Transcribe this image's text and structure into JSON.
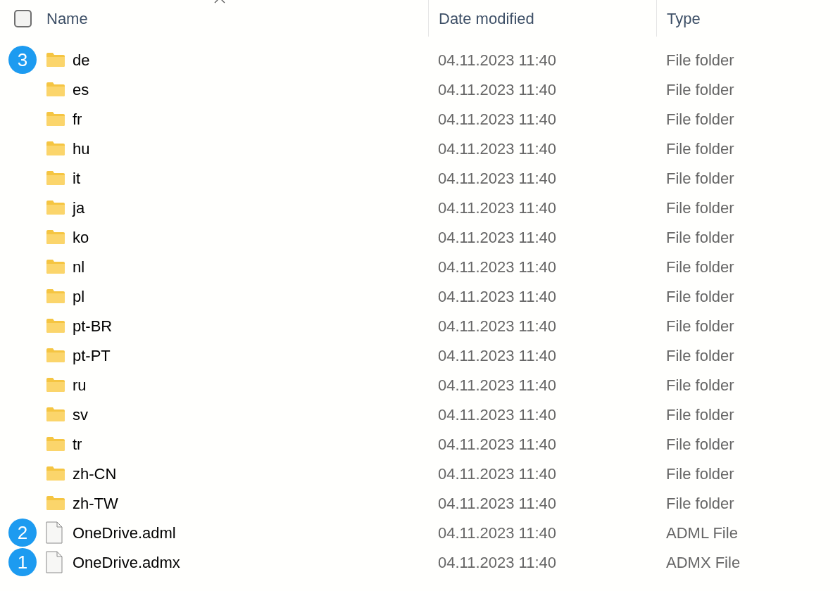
{
  "header": {
    "select_all": {
      "checked": false
    },
    "columns": [
      {
        "label": "Name",
        "sorted": true
      },
      {
        "label": "Date modified",
        "sorted": false
      },
      {
        "label": "Type",
        "sorted": false
      }
    ]
  },
  "rows": [
    {
      "kind": "folder",
      "name": "de",
      "date": "04.11.2023 11:40",
      "type": "File folder",
      "badge": "3"
    },
    {
      "kind": "folder",
      "name": "es",
      "date": "04.11.2023 11:40",
      "type": "File folder"
    },
    {
      "kind": "folder",
      "name": "fr",
      "date": "04.11.2023 11:40",
      "type": "File folder"
    },
    {
      "kind": "folder",
      "name": "hu",
      "date": "04.11.2023 11:40",
      "type": "File folder"
    },
    {
      "kind": "folder",
      "name": "it",
      "date": "04.11.2023 11:40",
      "type": "File folder"
    },
    {
      "kind": "folder",
      "name": "ja",
      "date": "04.11.2023 11:40",
      "type": "File folder"
    },
    {
      "kind": "folder",
      "name": "ko",
      "date": "04.11.2023 11:40",
      "type": "File folder"
    },
    {
      "kind": "folder",
      "name": "nl",
      "date": "04.11.2023 11:40",
      "type": "File folder"
    },
    {
      "kind": "folder",
      "name": "pl",
      "date": "04.11.2023 11:40",
      "type": "File folder"
    },
    {
      "kind": "folder",
      "name": "pt-BR",
      "date": "04.11.2023 11:40",
      "type": "File folder"
    },
    {
      "kind": "folder",
      "name": "pt-PT",
      "date": "04.11.2023 11:40",
      "type": "File folder"
    },
    {
      "kind": "folder",
      "name": "ru",
      "date": "04.11.2023 11:40",
      "type": "File folder"
    },
    {
      "kind": "folder",
      "name": "sv",
      "date": "04.11.2023 11:40",
      "type": "File folder"
    },
    {
      "kind": "folder",
      "name": "tr",
      "date": "04.11.2023 11:40",
      "type": "File folder"
    },
    {
      "kind": "folder",
      "name": "zh-CN",
      "date": "04.11.2023 11:40",
      "type": "File folder"
    },
    {
      "kind": "folder",
      "name": "zh-TW",
      "date": "04.11.2023 11:40",
      "type": "File folder"
    },
    {
      "kind": "file",
      "name": "OneDrive.adml",
      "date": "04.11.2023 11:40",
      "type": "ADML File",
      "badge": "2"
    },
    {
      "kind": "file",
      "name": "OneDrive.admx",
      "date": "04.11.2023 11:40",
      "type": "ADMX File",
      "badge": "1"
    }
  ]
}
